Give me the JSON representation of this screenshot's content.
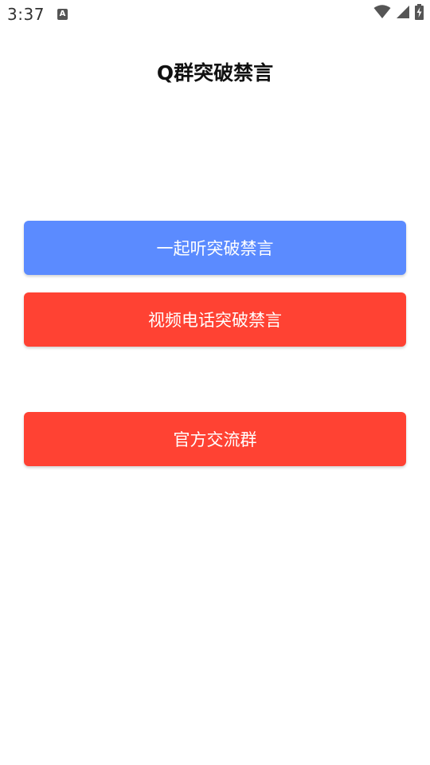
{
  "status_bar": {
    "time": "3:37",
    "notification_icon": "A",
    "icons": [
      "wifi-icon",
      "cell-signal-icon",
      "battery-charging-icon"
    ]
  },
  "header": {
    "title": "Q群突破禁言"
  },
  "buttons": [
    {
      "label": "一起听突破禁言",
      "color": "#5b8bff"
    },
    {
      "label": "视频电话突破禁言",
      "color": "#ff4233"
    },
    {
      "label": "官方交流群",
      "color": "#ff4233"
    }
  ]
}
